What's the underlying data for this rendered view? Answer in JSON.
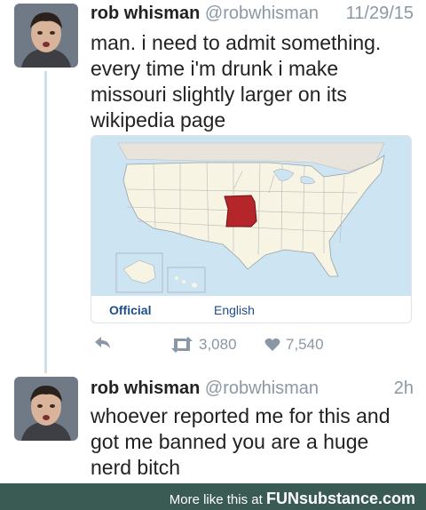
{
  "tweets": [
    {
      "name": "rob whisman",
      "handle": "@robwhisman",
      "date": "11/29/15",
      "lines": [
        "man. i need to admit something.",
        "every time i'm drunk i make",
        "missouri slightly larger on its",
        "wikipedia page"
      ],
      "card": {
        "official_label": "Official",
        "english_label": "English",
        "highlight_state": "Missouri",
        "highlight_color": "#b5262b"
      },
      "retweets": "3,080",
      "likes": "7,540"
    },
    {
      "name": "rob whisman",
      "handle": "@robwhisman",
      "date": "2h",
      "lines": [
        "whoever reported me for this and",
        "got me banned you are a huge",
        "nerd bitch"
      ]
    }
  ],
  "icons": {
    "reply": "reply-icon",
    "retweet": "retweet-icon",
    "like": "heart-icon"
  },
  "colors": {
    "handle": "#8a98a5",
    "link": "#1e4d8a",
    "footer": "#3a5a54",
    "thread_line": "#cfe0ec"
  },
  "footer": {
    "text": "More like this at",
    "brand": "FUNsubstance.com"
  }
}
